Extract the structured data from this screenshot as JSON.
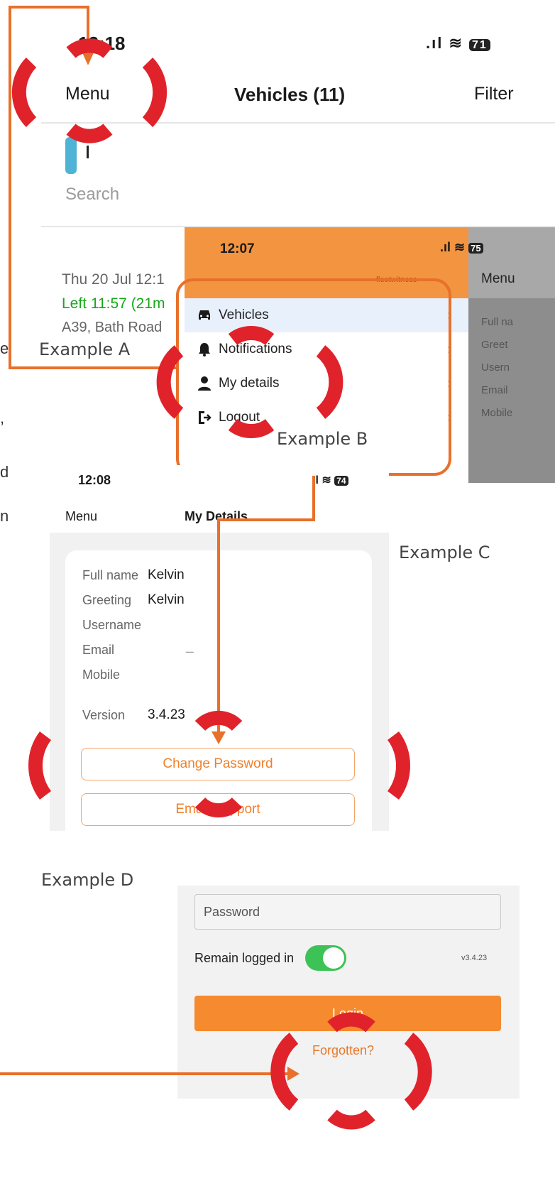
{
  "example_a": {
    "label": "Example A",
    "time": "12:18",
    "battery": "71",
    "menu": "Menu",
    "title": "Vehicles (11)",
    "filter": "Filter",
    "search_placeholder": "Search",
    "entry_date": "Thu 20 Jul 12:1",
    "entry_left": "Left 11:57 (21m",
    "entry_road": "A39, Bath Road"
  },
  "example_b": {
    "label": "Example B",
    "time": "12:07",
    "battery": "75",
    "logo": "fleetwitness",
    "side_menu": "Menu",
    "side_fields": [
      "Full na",
      "Greet",
      "Usern",
      "Email",
      "Mobile"
    ],
    "items": [
      {
        "label": "Vehicles",
        "icon": "car-icon"
      },
      {
        "label": "Notifications",
        "icon": "bell-icon"
      },
      {
        "label": "My details",
        "icon": "person-icon"
      },
      {
        "label": "Logout",
        "icon": "logout-icon"
      }
    ]
  },
  "example_c": {
    "label": "Example C",
    "time": "12:08",
    "battery": "74",
    "menu": "Menu",
    "title": "My Details",
    "fields": [
      {
        "label": "Full name",
        "value": "Kelvin"
      },
      {
        "label": "Greeting",
        "value": "Kelvin"
      },
      {
        "label": "Username",
        "value": ""
      },
      {
        "label": "Email",
        "value": "_"
      },
      {
        "label": "Mobile",
        "value": ""
      },
      {
        "label": "Version",
        "value": "3.4.23"
      }
    ],
    "change_password": "Change Password",
    "email_support": "Email Support"
  },
  "example_d": {
    "label": "Example D",
    "password_placeholder": "Password",
    "remain_logged_in": "Remain logged in",
    "remain_logged_in_on": true,
    "version": "v3.4.23",
    "login": "Login",
    "forgotten": "Forgotten?"
  },
  "left_clip": [
    "e",
    ",",
    "d",
    "n"
  ],
  "colors": {
    "accent": "#f39440",
    "highlight": "#e0232b",
    "connector": "#e8702a",
    "green": "#17a81a"
  }
}
